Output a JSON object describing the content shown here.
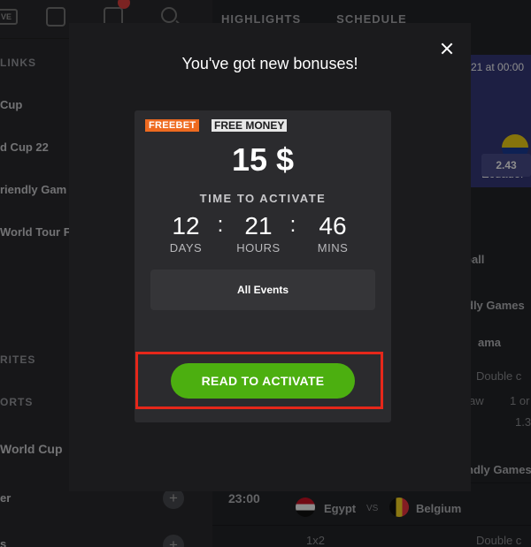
{
  "background": {
    "sidebar": {
      "live_label": "VE",
      "betslip_badge": "",
      "links_heading": "LINKS",
      "items": [
        "Cup",
        "d Cup 22",
        "riendly Gam",
        "World Tour F"
      ],
      "favorites_heading": "RITES",
      "sports_heading": "ORTS",
      "lower_items": [
        "World Cup",
        "er",
        "s"
      ]
    },
    "tabs": [
      "HIGHLIGHTS",
      "SCHEDULE"
    ],
    "featured": {
      "date": "21 at 00:00",
      "country": "Ecuador",
      "odds": "2.43"
    },
    "list": {
      "sport": "ball",
      "group1": "dly Games",
      "team": "ama",
      "market1": "Double c",
      "col_label": "aw",
      "cell_a": "1 or",
      "cell_b": "1.3",
      "group2": "ndly Games",
      "match_time": "23:00",
      "home": "Egypt",
      "vs": "VS",
      "away": "Belgium",
      "market2_a": "1x2",
      "market2_b": "Double c"
    }
  },
  "modal": {
    "title": "You've got new bonuses!",
    "bonus": {
      "tag_type": "FREEBET",
      "tag_kind": "FREE MONEY",
      "amount": "15 $",
      "time_label": "TIME TO ACTIVATE",
      "timer": [
        {
          "value": "12",
          "unit": "DAYS"
        },
        {
          "value": "21",
          "unit": "HOURS"
        },
        {
          "value": "46",
          "unit": "MINS"
        }
      ],
      "separator": ":",
      "events_label": "All Events",
      "button_label": "READ TO ACTIVATE"
    }
  },
  "colors": {
    "freebet_tag": "#ee6a20",
    "activate_button": "#4caf10",
    "highlight_frame": "#e6271a",
    "featured_card": "#35397a"
  }
}
